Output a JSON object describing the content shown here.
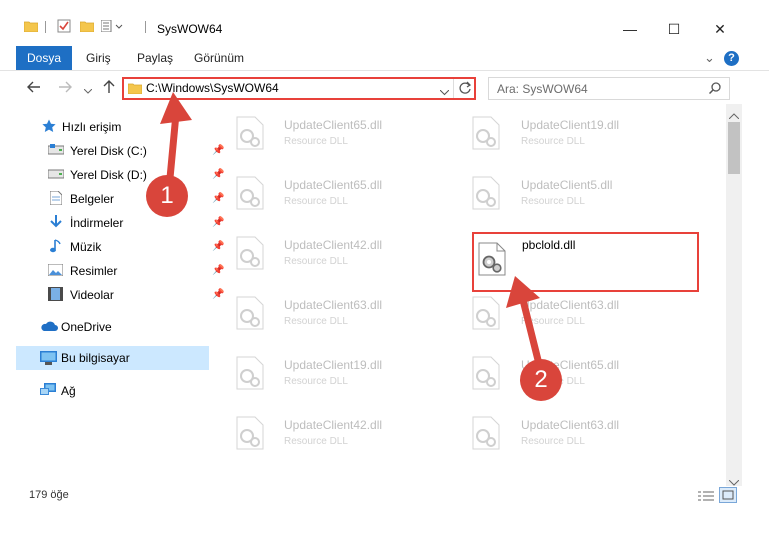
{
  "window": {
    "title": "SysWOW64",
    "minimize": "—",
    "maximize": "☐",
    "close": "✕"
  },
  "ribbon": {
    "tabs": [
      "Dosya",
      "Giriş",
      "Paylaş",
      "Görünüm"
    ],
    "collapse_chevron": "⌄",
    "help": "?"
  },
  "navigation": {
    "address": "C:\\Windows\\SysWOW64",
    "search_placeholder": "Ara: SysWOW64"
  },
  "sidebar": {
    "items": [
      {
        "label": "Hızlı erişim",
        "icon": "star-icon",
        "pinned": false
      },
      {
        "label": "Yerel Disk (C:)",
        "icon": "drive-icon",
        "pinned": true
      },
      {
        "label": "Yerel Disk (D:)",
        "icon": "drive-icon",
        "pinned": true
      },
      {
        "label": "Belgeler",
        "icon": "documents-icon",
        "pinned": true
      },
      {
        "label": "İndirmeler",
        "icon": "download-icon",
        "pinned": true
      },
      {
        "label": "Müzik",
        "icon": "music-icon",
        "pinned": true
      },
      {
        "label": "Resimler",
        "icon": "pictures-icon",
        "pinned": true
      },
      {
        "label": "Videolar",
        "icon": "videos-icon",
        "pinned": true
      },
      {
        "label": "OneDrive",
        "icon": "cloud-icon",
        "pinned": false
      },
      {
        "label": "Bu bilgisayar",
        "icon": "computer-icon",
        "pinned": false,
        "selected": true
      },
      {
        "label": "Ağ",
        "icon": "network-icon",
        "pinned": false
      }
    ]
  },
  "files": [
    {
      "name": "UpdateClient65.dll",
      "type": "Resource DLL"
    },
    {
      "name": "UpdateClient19.dll",
      "type": "Resource DLL"
    },
    {
      "name": "UpdateClient65.dll",
      "type": "Resource DLL"
    },
    {
      "name": "UpdateClient5.dll",
      "type": "Resource DLL"
    },
    {
      "name": "UpdateClient42.dll",
      "type": "Resource DLL"
    },
    {
      "name": "pbclold.dll",
      "type": "",
      "highlighted": true
    },
    {
      "name": "UpdateClient63.dll",
      "type": "Resource DLL"
    },
    {
      "name": "UpdateClient63.dll",
      "type": "Resource DLL"
    },
    {
      "name": "UpdateClient19.dll",
      "type": "Resource DLL"
    },
    {
      "name": "UpdateClient65.dll",
      "type": "Resource DLL"
    },
    {
      "name": "UpdateClient42.dll",
      "type": "Resource DLL"
    },
    {
      "name": "UpdateClient63.dll",
      "type": "Resource DLL"
    }
  ],
  "status": {
    "count": "179 öğe"
  },
  "callouts": [
    "1",
    "2"
  ],
  "colors": {
    "accent": "#1e6fc4",
    "highlight": "#e8413a",
    "callout": "#d9453b",
    "selection": "#cce8ff"
  }
}
